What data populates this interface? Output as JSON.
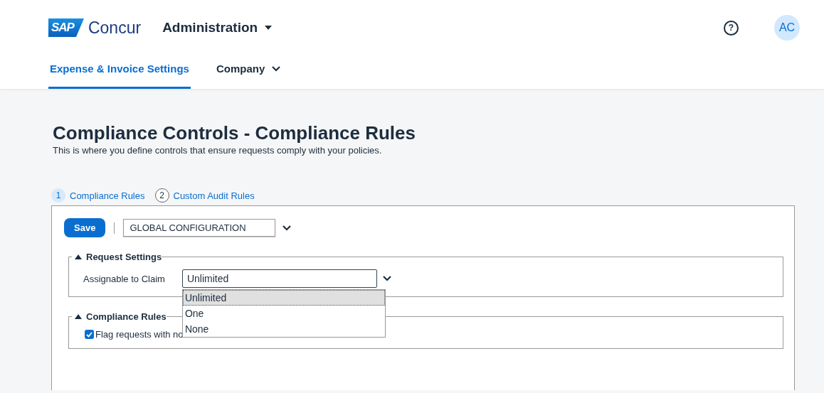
{
  "header": {
    "brand_mark": "SAP",
    "brand_name": "Concur",
    "module": "Administration",
    "help": "?",
    "avatar": "AC"
  },
  "tabs": [
    {
      "label": "Expense & Invoice Settings",
      "selected": true,
      "dropdown": false
    },
    {
      "label": "Company",
      "selected": false,
      "dropdown": true
    }
  ],
  "page": {
    "title": "Compliance Controls - Compliance Rules",
    "subtitle": "This is where you define controls that ensure requests comply with your policies."
  },
  "steps": [
    {
      "number": "1",
      "label": "Compliance Rules",
      "selected": true
    },
    {
      "number": "2",
      "label": "Custom Audit Rules",
      "selected": false
    }
  ],
  "toolbar": {
    "save": "Save",
    "configuration": "GLOBAL CONFIGURATION"
  },
  "sections": [
    {
      "title": "Request Settings",
      "expanded": true,
      "kind": "select",
      "label": "Assignable to Claim",
      "value": "Unlimited",
      "options": [
        {
          "label": "Unlimited",
          "selected": true
        },
        {
          "label": "One",
          "selected": false
        },
        {
          "label": "None",
          "selected": false
        }
      ]
    },
    {
      "title": "Compliance Rules",
      "expanded": true,
      "kind": "checkbox",
      "label": "Flag requests with no",
      "checked": true
    }
  ]
}
